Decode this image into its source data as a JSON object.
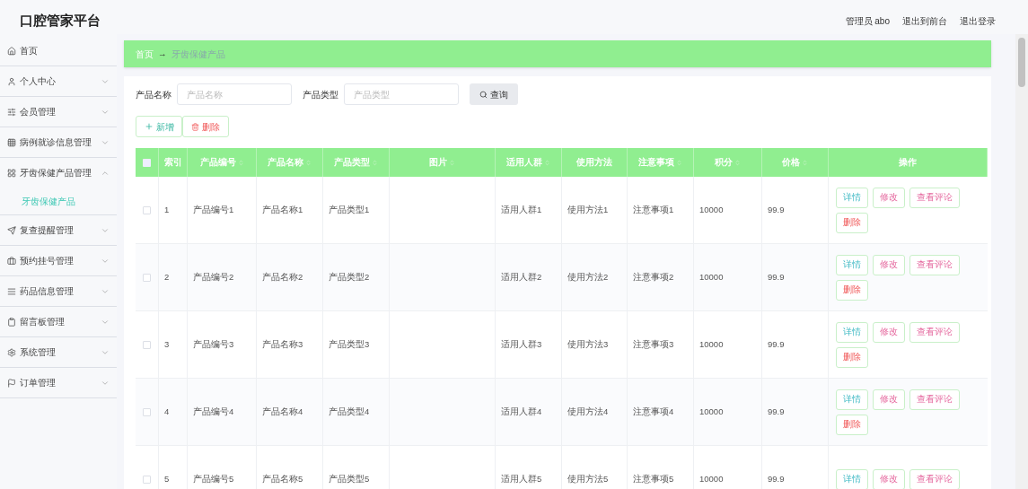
{
  "header": {
    "title": "口腔管家平台",
    "user": "管理员 abo",
    "links": [
      "退出到前台",
      "退出登录"
    ]
  },
  "sidebar": {
    "items": [
      {
        "label": "首页",
        "kind": "link"
      },
      {
        "label": "个人中心",
        "kind": "menu",
        "expanded": false
      },
      {
        "label": "会员管理",
        "kind": "menu",
        "expanded": false
      },
      {
        "label": "病例就诊信息管理",
        "kind": "menu",
        "expanded": false
      },
      {
        "label": "牙齿保健产品管理",
        "kind": "menu",
        "expanded": true,
        "children": [
          {
            "label": "牙齿保健产品",
            "selected": true
          }
        ]
      },
      {
        "label": "复查提醒管理",
        "kind": "menu",
        "expanded": false
      },
      {
        "label": "预约挂号管理",
        "kind": "menu",
        "expanded": false
      },
      {
        "label": "药品信息管理",
        "kind": "menu",
        "expanded": false
      },
      {
        "label": "留言板管理",
        "kind": "menu",
        "expanded": false
      },
      {
        "label": "系统管理",
        "kind": "menu",
        "expanded": false
      },
      {
        "label": "订单管理",
        "kind": "menu",
        "expanded": false
      }
    ]
  },
  "breadcrumb": {
    "home": "首页",
    "separator": "→",
    "current": "牙齿保健产品"
  },
  "search": {
    "fields": [
      {
        "label": "产品名称",
        "placeholder": "产品名称"
      },
      {
        "label": "产品类型",
        "placeholder": "产品类型"
      }
    ],
    "button": "查询"
  },
  "toolbar": {
    "add": "新增",
    "delete": "删除"
  },
  "table": {
    "all_checked": false,
    "columns": [
      {
        "label": "索引",
        "sortable": false
      },
      {
        "label": "产品编号",
        "sortable": true
      },
      {
        "label": "产品名称",
        "sortable": true
      },
      {
        "label": "产品类型",
        "sortable": true
      },
      {
        "label": "图片",
        "sortable": true
      },
      {
        "label": "适用人群",
        "sortable": true
      },
      {
        "label": "使用方法",
        "sortable": false
      },
      {
        "label": "注意事项",
        "sortable": true
      },
      {
        "label": "积分",
        "sortable": true
      },
      {
        "label": "价格",
        "sortable": true
      },
      {
        "label": "操作",
        "sortable": false
      }
    ],
    "rows": [
      {
        "checked": false,
        "cells": [
          "1",
          "产品编号1",
          "产品名称1",
          "产品类型1",
          "",
          "适用人群1",
          "使用方法1",
          "注意事项1",
          "10000",
          "99.9"
        ],
        "actions": [
          {
            "label": "详情",
            "kind": "detail"
          },
          {
            "label": "修改",
            "kind": "edit"
          },
          {
            "label": "查看评论",
            "kind": "comments"
          },
          {
            "label": "删除",
            "kind": "delete"
          }
        ]
      },
      {
        "checked": false,
        "cells": [
          "2",
          "产品编号2",
          "产品名称2",
          "产品类型2",
          "",
          "适用人群2",
          "使用方法2",
          "注意事项2",
          "10000",
          "99.9"
        ],
        "actions": [
          {
            "label": "详情",
            "kind": "detail"
          },
          {
            "label": "修改",
            "kind": "edit"
          },
          {
            "label": "查看评论",
            "kind": "comments"
          },
          {
            "label": "删除",
            "kind": "delete"
          }
        ]
      },
      {
        "checked": false,
        "cells": [
          "3",
          "产品编号3",
          "产品名称3",
          "产品类型3",
          "",
          "适用人群3",
          "使用方法3",
          "注意事项3",
          "10000",
          "99.9"
        ],
        "actions": [
          {
            "label": "详情",
            "kind": "detail"
          },
          {
            "label": "修改",
            "kind": "edit"
          },
          {
            "label": "查看评论",
            "kind": "comments"
          },
          {
            "label": "删除",
            "kind": "delete"
          }
        ]
      },
      {
        "checked": false,
        "cells": [
          "4",
          "产品编号4",
          "产品名称4",
          "产品类型4",
          "",
          "适用人群4",
          "使用方法4",
          "注意事项4",
          "10000",
          "99.9"
        ],
        "actions": [
          {
            "label": "详情",
            "kind": "detail"
          },
          {
            "label": "修改",
            "kind": "edit"
          },
          {
            "label": "查看评论",
            "kind": "comments"
          },
          {
            "label": "删除",
            "kind": "delete"
          }
        ]
      },
      {
        "checked": false,
        "cells": [
          "5",
          "产品编号5",
          "产品名称5",
          "产品类型5",
          "",
          "适用人群5",
          "使用方法5",
          "注意事项5",
          "10000",
          "99.9"
        ],
        "actions": [
          {
            "label": "详情",
            "kind": "detail"
          },
          {
            "label": "修改",
            "kind": "edit"
          },
          {
            "label": "查看评论",
            "kind": "comments"
          }
        ]
      }
    ]
  }
}
